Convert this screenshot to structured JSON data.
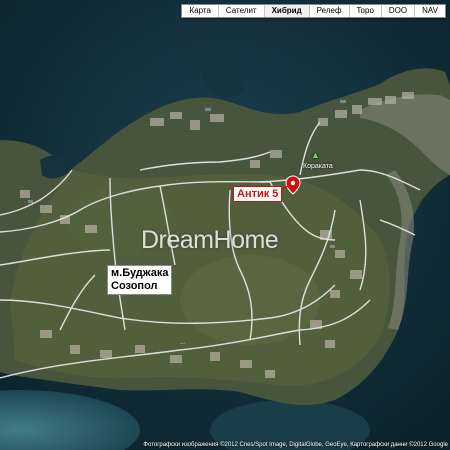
{
  "map_type_bar": {
    "buttons": [
      {
        "label": "Карта",
        "active": false
      },
      {
        "label": "Сателит",
        "active": false
      },
      {
        "label": "Хибрид",
        "active": true
      },
      {
        "label": "Релеф",
        "active": false
      },
      {
        "label": "Topo",
        "active": false
      },
      {
        "label": "DOO",
        "active": false
      },
      {
        "label": "NAV",
        "active": false
      }
    ]
  },
  "labels": {
    "area_line1": "м.Буджака",
    "area_line2": "Созопол",
    "poi": "Антик 5",
    "place": "Кораката"
  },
  "watermark": "DreamHome",
  "copyright": "Фотографски изображения ©2012 Cnes/Spot Image, DigitalGlobe, GeoEye, Картографски данни ©2012 Google",
  "colors": {
    "sea": "#0f2a36",
    "land": "#4a5a3e",
    "road": "#e6e6e6",
    "poi_accent": "#d01010"
  },
  "icons": {
    "marker": "map-pin-icon",
    "park": "park-icon"
  }
}
